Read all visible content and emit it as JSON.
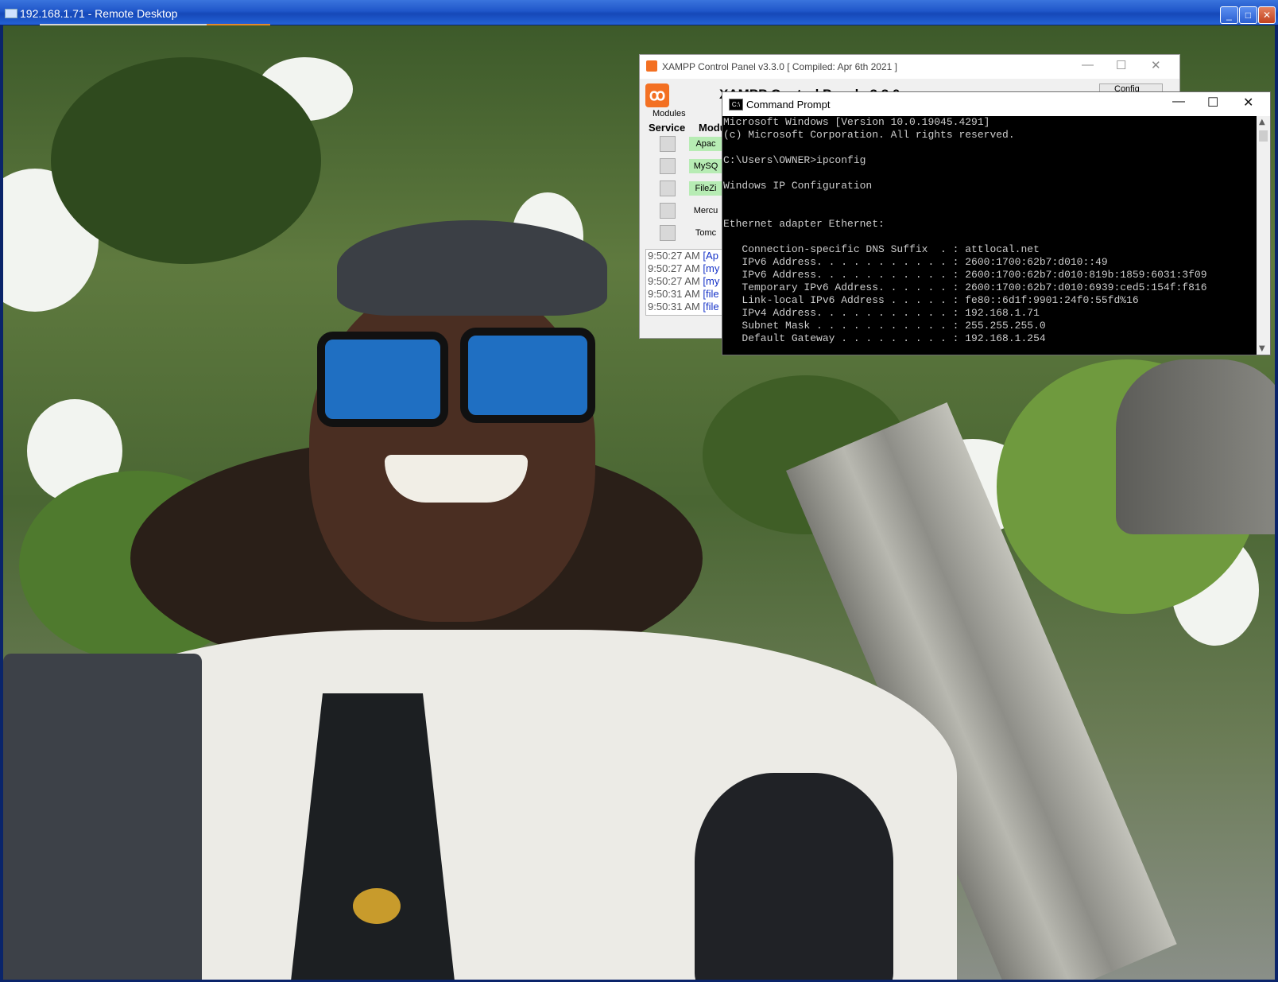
{
  "remote_desktop": {
    "title": "192.168.1.71 - Remote Desktop",
    "controls": {
      "minimize": "_",
      "maximize": "□",
      "close": "✕"
    }
  },
  "xampp": {
    "title": "XAMPP Control Panel v3.3.0   [ Compiled: Apr 6th 2021 ]",
    "modules_label": "Modules",
    "service_header": "Service",
    "module_header": "Modu",
    "config_button": "Config",
    "heading": "XAMPP Control Panel v3.3.0",
    "modules": [
      {
        "name": "Apac",
        "running": true
      },
      {
        "name": "MySQ",
        "running": true
      },
      {
        "name": "FileZi",
        "running": true
      },
      {
        "name": "Mercu",
        "running": false
      },
      {
        "name": "Tomc",
        "running": false
      }
    ],
    "log": [
      {
        "time": "9:50:27 AM",
        "tag": "[Ap"
      },
      {
        "time": "9:50:27 AM",
        "tag": "[my"
      },
      {
        "time": "9:50:27 AM",
        "tag": "[my"
      },
      {
        "time": "9:50:31 AM",
        "tag": "[file"
      },
      {
        "time": "9:50:31 AM",
        "tag": "[file"
      }
    ]
  },
  "cmd": {
    "title": "Command Prompt",
    "lines": [
      "Microsoft Windows [Version 10.0.19045.4291]",
      "(c) Microsoft Corporation. All rights reserved.",
      "",
      "C:\\Users\\OWNER>ipconfig",
      "",
      "Windows IP Configuration",
      "",
      "",
      "Ethernet adapter Ethernet:",
      "",
      "   Connection-specific DNS Suffix  . : attlocal.net",
      "   IPv6 Address. . . . . . . . . . . : 2600:1700:62b7:d010::49",
      "   IPv6 Address. . . . . . . . . . . : 2600:1700:62b7:d010:819b:1859:6031:3f09",
      "   Temporary IPv6 Address. . . . . . : 2600:1700:62b7:d010:6939:ced5:154f:f816",
      "   Link-local IPv6 Address . . . . . : fe80::6d1f:9901:24f0:55fd%16",
      "   IPv4 Address. . . . . . . . . . . : 192.168.1.71",
      "   Subnet Mask . . . . . . . . . . . : 255.255.255.0",
      "   Default Gateway . . . . . . . . . : 192.168.1.254"
    ]
  },
  "colors": {
    "xp_titlebar": "#1f56c9",
    "cmd_text": "#cccccc",
    "xampp_orange": "#f37022",
    "module_running": "#b7ecb4"
  }
}
